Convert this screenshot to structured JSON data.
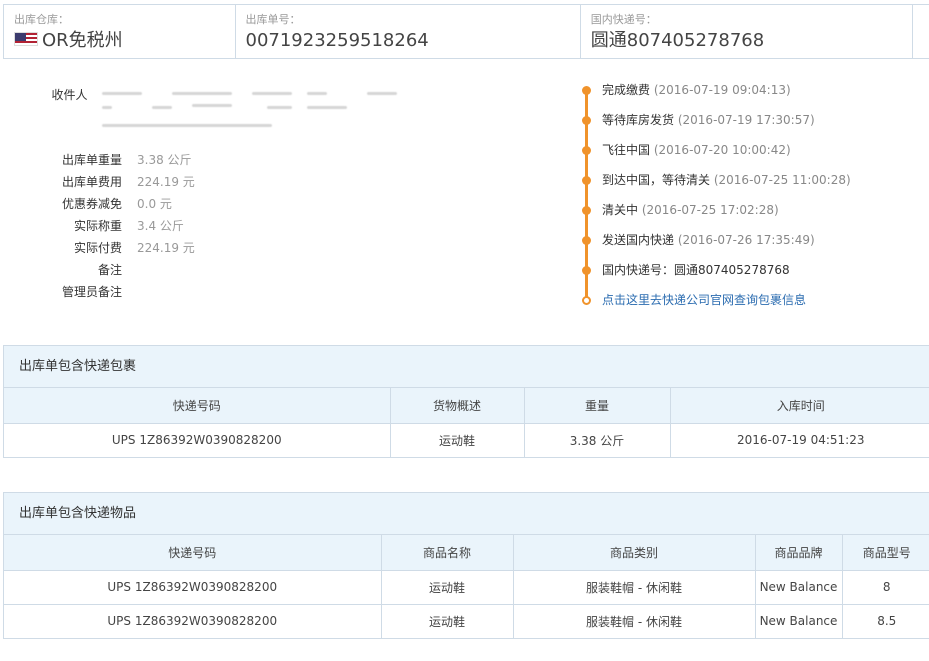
{
  "summary": {
    "warehouse_label": "出库仓库：",
    "warehouse_value": "OR免税州",
    "order_label": "出库单号：",
    "order_value": "0071923259518264",
    "domestic_label": "国内快递号：",
    "domestic_value": "圆通807405278768"
  },
  "info": {
    "receiver_label": "收件人",
    "rows": [
      {
        "label": "出库单重量",
        "value": "3.38 公斤"
      },
      {
        "label": "出库单费用",
        "value": "224.19 元"
      },
      {
        "label": "优惠券减免",
        "value": "0.0 元"
      },
      {
        "label": "实际称重",
        "value": "3.4 公斤"
      },
      {
        "label": "实际付费",
        "value": "224.19 元"
      },
      {
        "label": "备注",
        "value": ""
      },
      {
        "label": "管理员备注",
        "value": ""
      }
    ]
  },
  "timeline": [
    {
      "text": "完成缴费",
      "time": "(2016-07-19 09:04:13)"
    },
    {
      "text": "等待库房发货",
      "time": "(2016-07-19 17:30:57)"
    },
    {
      "text": "飞往中国",
      "time": "(2016-07-20 10:00:42)"
    },
    {
      "text": "到达中国，等待清关",
      "time": "(2016-07-25 11:00:28)"
    },
    {
      "text": "清关中",
      "time": "(2016-07-25 17:02:28)"
    },
    {
      "text": "发送国内快递",
      "time": "(2016-07-26 17:35:49)"
    },
    {
      "text": "国内快递号：圆通807405278768",
      "time": ""
    }
  ],
  "timeline_link": "点击这里去快递公司官网查询包裹信息",
  "packages": {
    "title": "出库单包含快递包裹",
    "headers": [
      "快递号码",
      "货物概述",
      "重量",
      "入库时间"
    ],
    "rows": [
      [
        "UPS 1Z86392W0390828200",
        "运动鞋",
        "3.38 公斤",
        "2016-07-19 04:51:23"
      ]
    ]
  },
  "items": {
    "title": "出库单包含快递物品",
    "headers": [
      "快递号码",
      "商品名称",
      "商品类别",
      "商品品牌",
      "商品型号"
    ],
    "rows": [
      [
        "UPS 1Z86392W0390828200",
        "运动鞋",
        "服装鞋帽 - 休闲鞋",
        "New Balance",
        "8"
      ],
      [
        "UPS 1Z86392W0390828200",
        "运动鞋",
        "服装鞋帽 - 休闲鞋",
        "New Balance",
        "8.5"
      ]
    ]
  },
  "colors": {
    "accent": "#f0932b",
    "header_bg": "#eaf4fb",
    "border": "#cfdbe6",
    "link": "#2b6cb0"
  }
}
